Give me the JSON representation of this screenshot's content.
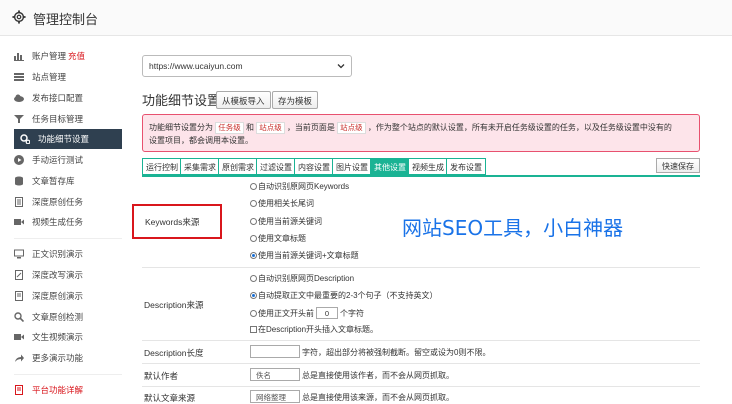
{
  "header": {
    "title": "管理控制台",
    "icon": "gear-icon"
  },
  "sidebar": {
    "items": [
      {
        "label": "账户管理",
        "badge": "充值",
        "icon": "bar-chart-icon"
      },
      {
        "label": "站点管理",
        "icon": "list-icon"
      },
      {
        "label": "发布接口配置",
        "icon": "cloud-icon"
      },
      {
        "label": "任务目标管理",
        "icon": "filter-icon"
      },
      {
        "label": "功能细节设置",
        "icon": "gears-icon",
        "active": true
      },
      {
        "label": "手动运行测试",
        "icon": "play-icon"
      },
      {
        "label": "文章暂存库",
        "icon": "database-icon"
      },
      {
        "label": "深度原创任务",
        "icon": "document-icon"
      },
      {
        "label": "视频生成任务",
        "icon": "video-icon"
      },
      {
        "label": "正文识别演示",
        "icon": "monitor-icon"
      },
      {
        "label": "深度改写演示",
        "icon": "pencil-icon"
      },
      {
        "label": "深度原创演示",
        "icon": "document-icon"
      },
      {
        "label": "文章原创检测",
        "icon": "search-icon"
      },
      {
        "label": "文生视频演示",
        "icon": "video-icon"
      },
      {
        "label": "更多演示功能",
        "icon": "share-icon"
      },
      {
        "label": "平台功能详解",
        "icon": "document-icon",
        "red": true
      }
    ]
  },
  "main": {
    "site_select": {
      "value": "https://www.ucaiyun.com"
    },
    "section_title": "功能细节设置",
    "buttons": {
      "import_template": "从模板导入",
      "save_template": "存为模板"
    },
    "alert": {
      "p1": "功能细节设置分为",
      "tag1": "任务级",
      "p2": "和",
      "tag2": "站点级",
      "p3": "，当前页面是",
      "tag3": "站点级",
      "p4": "，作为整个站点的默认设置，所有未开启任务级设置的任务，以及任务级设置中没有的",
      "line2": "设置项目，都会调用本设置。"
    },
    "tabs": [
      "运行控制",
      "采集需求",
      "原创需求",
      "过滤设置",
      "内容设置",
      "图片设置",
      "其他设置",
      "视频生成",
      "发布设置"
    ],
    "active_tab": "其他设置",
    "quick_save": "快速保存",
    "keywords": {
      "label": "Keywords来源",
      "options": [
        "自动识别原网页Keywords",
        "使用相关长尾词",
        "使用当前源关键词",
        "使用文章标题",
        "使用当前源关键词+文章标题"
      ],
      "selected": 4
    },
    "description": {
      "label": "Description来源",
      "opt1": "自动识别原网页Description",
      "opt2": "自动提取正文中最重要的2-3个句子（不支持英文）",
      "opt3_prefix": "使用正文开头前",
      "opt3_value": "0",
      "opt3_suffix": "个字符",
      "check": "在Description开头插入文章标题。",
      "selected": 2
    },
    "desc_length": {
      "label": "Description长度",
      "hint": "字符，超出部分将被强制截断。留空或设为0则不限。"
    },
    "author": {
      "label": "默认作者",
      "placeholder": "佚名",
      "hint": "总是直接使用该作者，而不会从网页抓取。"
    },
    "source": {
      "label": "默认文章来源",
      "placeholder": "网络整理",
      "hint": "总是直接使用该来源，而不会从网页抓取。"
    }
  },
  "overlay": {
    "text": "网站SEO工具，小白神器"
  },
  "colors": {
    "accent": "#1ab394",
    "nav_active": "#2f4050",
    "alert_border": "#e8516f",
    "highlight_red": "#d9161c",
    "overlay_blue": "#1a73e8"
  }
}
